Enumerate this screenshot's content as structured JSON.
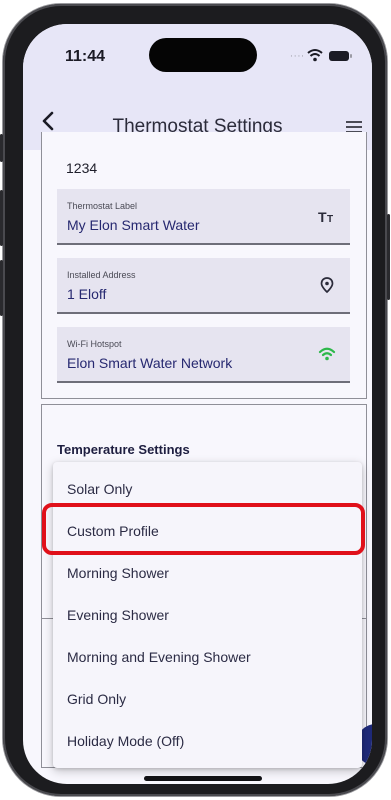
{
  "status_bar": {
    "time": "11:44"
  },
  "header": {
    "back_icon": "chevron-left-icon",
    "title": "Thermostat Settings",
    "menu_icon": "hamburger-menu-icon"
  },
  "device": {
    "code": "1234",
    "fields": [
      {
        "label": "Thermostat Label",
        "value": "My Elon Smart Water",
        "icon": "text-size-icon"
      },
      {
        "label": "Installed Address",
        "value": "1 Eloff",
        "icon": "location-pin-icon"
      },
      {
        "label": "Wi-Fi Hotspot",
        "value": "Elon Smart Water Network",
        "icon": "wifi-icon"
      }
    ]
  },
  "temperature": {
    "section_title": "Temperature Settings",
    "options": [
      "Solar Only",
      "Custom Profile",
      "Morning Shower",
      "Evening Shower",
      "Morning and Evening Shower",
      "Grid Only",
      "Holiday Mode (Off)"
    ],
    "highlighted_option": "Custom Profile"
  },
  "colors": {
    "header_bg": "#e7e6f7",
    "accent_text": "#262870",
    "highlight_border": "#e0101a",
    "wifi_green": "#2db84a"
  }
}
